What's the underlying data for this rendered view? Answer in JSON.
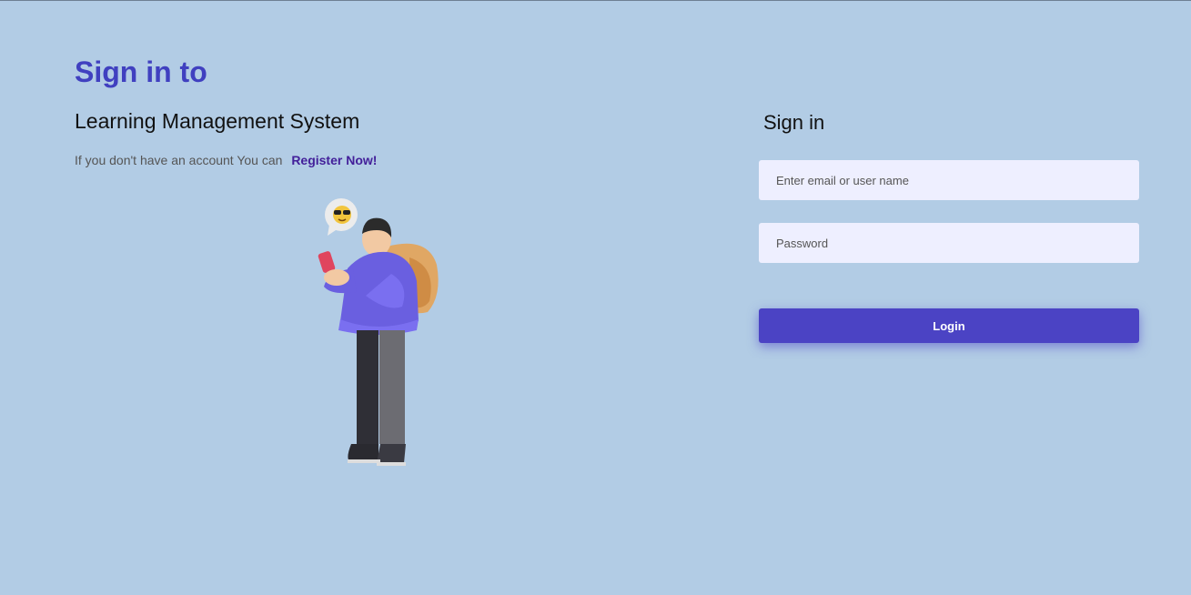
{
  "hero": {
    "title": "Sign in to",
    "subtitle": "Learning Management System",
    "register_prompt": "If you don't have an account You can",
    "register_link": "Register Now!"
  },
  "illustration": {
    "icon": "person-with-phone-illustration",
    "emoji": "😎"
  },
  "form": {
    "title": "Sign in",
    "email_placeholder": "Enter email or user name",
    "email_value": "",
    "password_placeholder": "Password",
    "password_value": "",
    "login_label": "Login"
  },
  "colors": {
    "background": "#b2cce5",
    "accent": "#4b43c4",
    "title": "#4040c0",
    "link": "#43209a",
    "input_bg": "#eeefff"
  }
}
